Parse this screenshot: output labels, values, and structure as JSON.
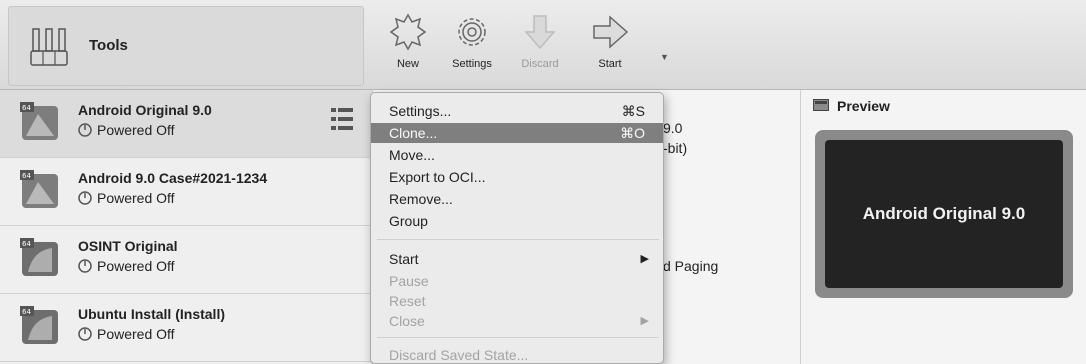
{
  "toolbar": {
    "tools_label": "Tools",
    "buttons": {
      "new": "New",
      "settings": "Settings",
      "discard": "Discard",
      "start": "Start"
    }
  },
  "vms": [
    {
      "name": "Android Original 9.0",
      "state": "Powered Off"
    },
    {
      "name": "Android 9.0 Case#2021-1234",
      "state": "Powered Off"
    },
    {
      "name": "OSINT Original",
      "state": "Powered Off"
    },
    {
      "name": "Ubuntu Install (Install)",
      "state": "Powered Off"
    }
  ],
  "details": {
    "line1": "9.0",
    "line2": "-bit)",
    "line3": "d Paging"
  },
  "preview": {
    "title": "Preview",
    "screen_text": "Android Original 9.0"
  },
  "context_menu": {
    "settings": "Settings...",
    "settings_shortcut": "⌘S",
    "clone": "Clone...",
    "clone_shortcut": "⌘O",
    "move": "Move...",
    "export": "Export to OCI...",
    "remove": "Remove...",
    "group": "Group",
    "start": "Start",
    "pause": "Pause",
    "reset": "Reset",
    "close": "Close",
    "discard_state": "Discard Saved State..."
  }
}
